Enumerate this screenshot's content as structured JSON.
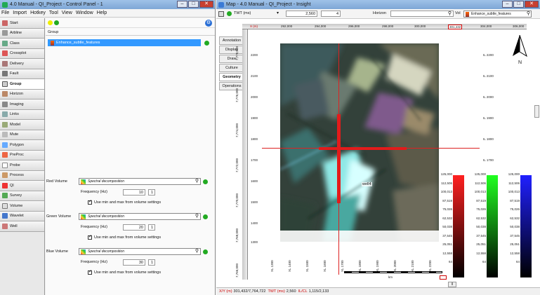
{
  "left_window": {
    "title": "4.0 Manual - QI_Project - Control Panel - 1",
    "menu": [
      "File",
      "Import",
      "Hotkey",
      "Tool",
      "View",
      "Window",
      "Help"
    ],
    "sidebar": [
      "Start",
      "Arbline",
      "Class",
      "Crossplot",
      "Delivery",
      "Fault",
      "Group",
      "Horizon",
      "Imaging",
      "Links",
      "Model",
      "Mute",
      "Polygon",
      "PreProc",
      "Probe",
      "Process",
      "QI",
      "Survey",
      "Volume",
      "Wavelet",
      "Well"
    ],
    "active_item": "Group",
    "group_header": "Group",
    "group_row": "Enhance_subtle_features",
    "volumes": [
      {
        "label": "Red Volume",
        "name": "Spectral decomposition",
        "freq_label": "Frequency (Hz)",
        "freq": "10",
        "step": "1",
        "minmax": "Use min and max from volume settings"
      },
      {
        "label": "Green Volume",
        "name": "Spectral decomposition",
        "freq_label": "Frequency (Hz)",
        "freq": "20",
        "step": "1",
        "minmax": "Use min and max from volume settings"
      },
      {
        "label": "Blue Volume",
        "name": "Spectral decomposition",
        "freq_label": "Frequency (Hz)",
        "freq": "30",
        "step": "1",
        "minmax": "Use min and max from volume settings"
      }
    ]
  },
  "right_window": {
    "title": "Map - 4.0 Manual - QI_Project - Insight",
    "twt_label": "TWT (ms)",
    "twt_value": "2,560",
    "step": "4",
    "horizon_label": "Horizon",
    "vol_label": "Vol",
    "vol_value": "Enhance_subtle_features",
    "tabs": [
      "Annotation",
      "Display",
      "Draw",
      "Culture",
      "Geometry",
      "Operations"
    ],
    "x_axis_label": "X (m)",
    "x_ticks": [
      "292,000",
      "294,000",
      "296,000",
      "298,000",
      "300,000",
      "301,432",
      "304,000",
      "306,000"
    ],
    "y_ticks": [
      "2200",
      "2100",
      "2000",
      "1900",
      "1800",
      "1700",
      "1600",
      "1500",
      "1400",
      "1300"
    ],
    "y_coords": [
      "7,778,000",
      "7,776,000",
      "7,774,000",
      "7,772,000",
      "7,770,000",
      "7,768,000",
      "7,766,000"
    ],
    "il_ticks": [
      "IL 2200",
      "IL 2100",
      "IL 2000",
      "IL 1900",
      "IL 1800",
      "IL 1700"
    ],
    "xl_ticks": [
      "XL 1300",
      "XL 1400",
      "XL 1500",
      "XL 1600",
      "XL 1700",
      "XL 1800",
      "XL 1900",
      "XL 2000",
      "XL 2100",
      "XL 2200"
    ],
    "well_label": "well4",
    "north": "N",
    "colorbar_values": [
      "125,000",
      "112,506",
      "100,013",
      "87,519",
      "75,026",
      "62,532",
      "50,038",
      "37,545",
      "25,051",
      "12,558",
      "64"
    ],
    "colorbar_colors": {
      "red": "#ff0000",
      "green": "#00ff00",
      "blue": "#0000ff"
    },
    "scale_unit": "km",
    "status": {
      "xy_label": "X/Y (m)",
      "xy": "301,432/7,764,722",
      "twt_label": "TWT (ms)",
      "twt": "2,560",
      "ilcl_label": "IL/CL",
      "ilcl": "1,115/2,133"
    }
  }
}
